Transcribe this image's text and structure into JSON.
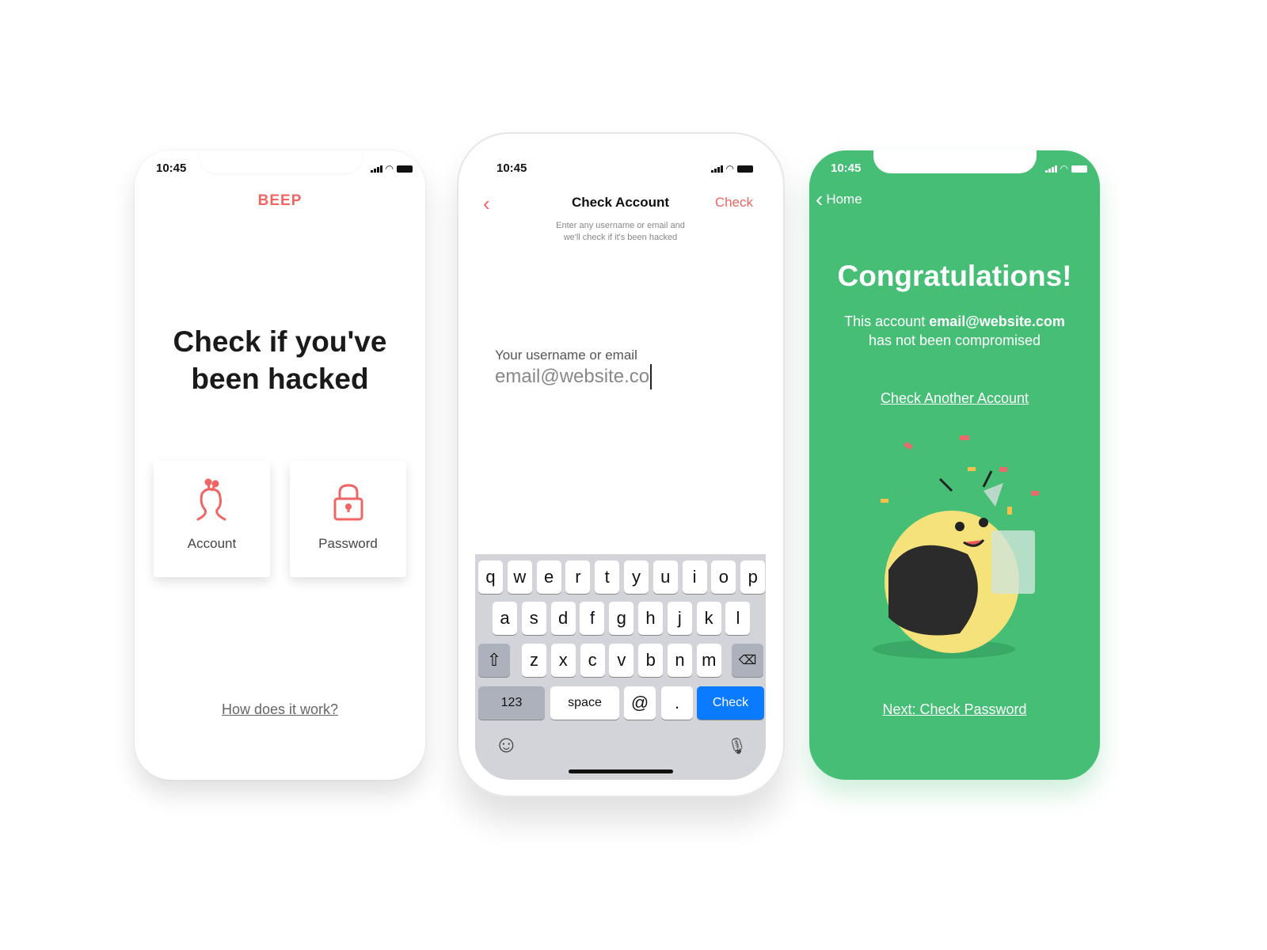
{
  "status": {
    "time": "10:45"
  },
  "screen1": {
    "logo": "BEEP",
    "headline_line1": "Check if you've",
    "headline_line2": "been hacked",
    "cards": [
      {
        "label": "Account",
        "icon": "person-antenna-icon"
      },
      {
        "label": "Password",
        "icon": "lock-icon"
      }
    ],
    "link": "How does it work?"
  },
  "screen2": {
    "title": "Check Account",
    "action": "Check",
    "subtitle_line1": "Enter any username or email and",
    "subtitle_line2": "we'll check if it's been hacked",
    "field_label": "Your username or email",
    "field_value": "email@website.co",
    "keyboard": {
      "row1": [
        "q",
        "w",
        "e",
        "r",
        "t",
        "y",
        "u",
        "i",
        "o",
        "p"
      ],
      "row2": [
        "a",
        "s",
        "d",
        "f",
        "g",
        "h",
        "j",
        "k",
        "l"
      ],
      "row3": [
        "z",
        "x",
        "c",
        "v",
        "b",
        "n",
        "m"
      ],
      "numbers": "123",
      "space": "space",
      "at": "@",
      "dot": ".",
      "return": "Check"
    }
  },
  "screen3": {
    "back": "Home",
    "title": "Congratulations!",
    "msg_prefix": "This account ",
    "msg_email": "email@website.com",
    "msg_line2": "has not been compromised",
    "link1": "Check Another Account",
    "link2": "Next: Check Password"
  },
  "colors": {
    "accent": "#F06563",
    "green": "#46BE76",
    "ios_blue": "#0A7AFF",
    "keyboard": "#D2D4DA"
  }
}
